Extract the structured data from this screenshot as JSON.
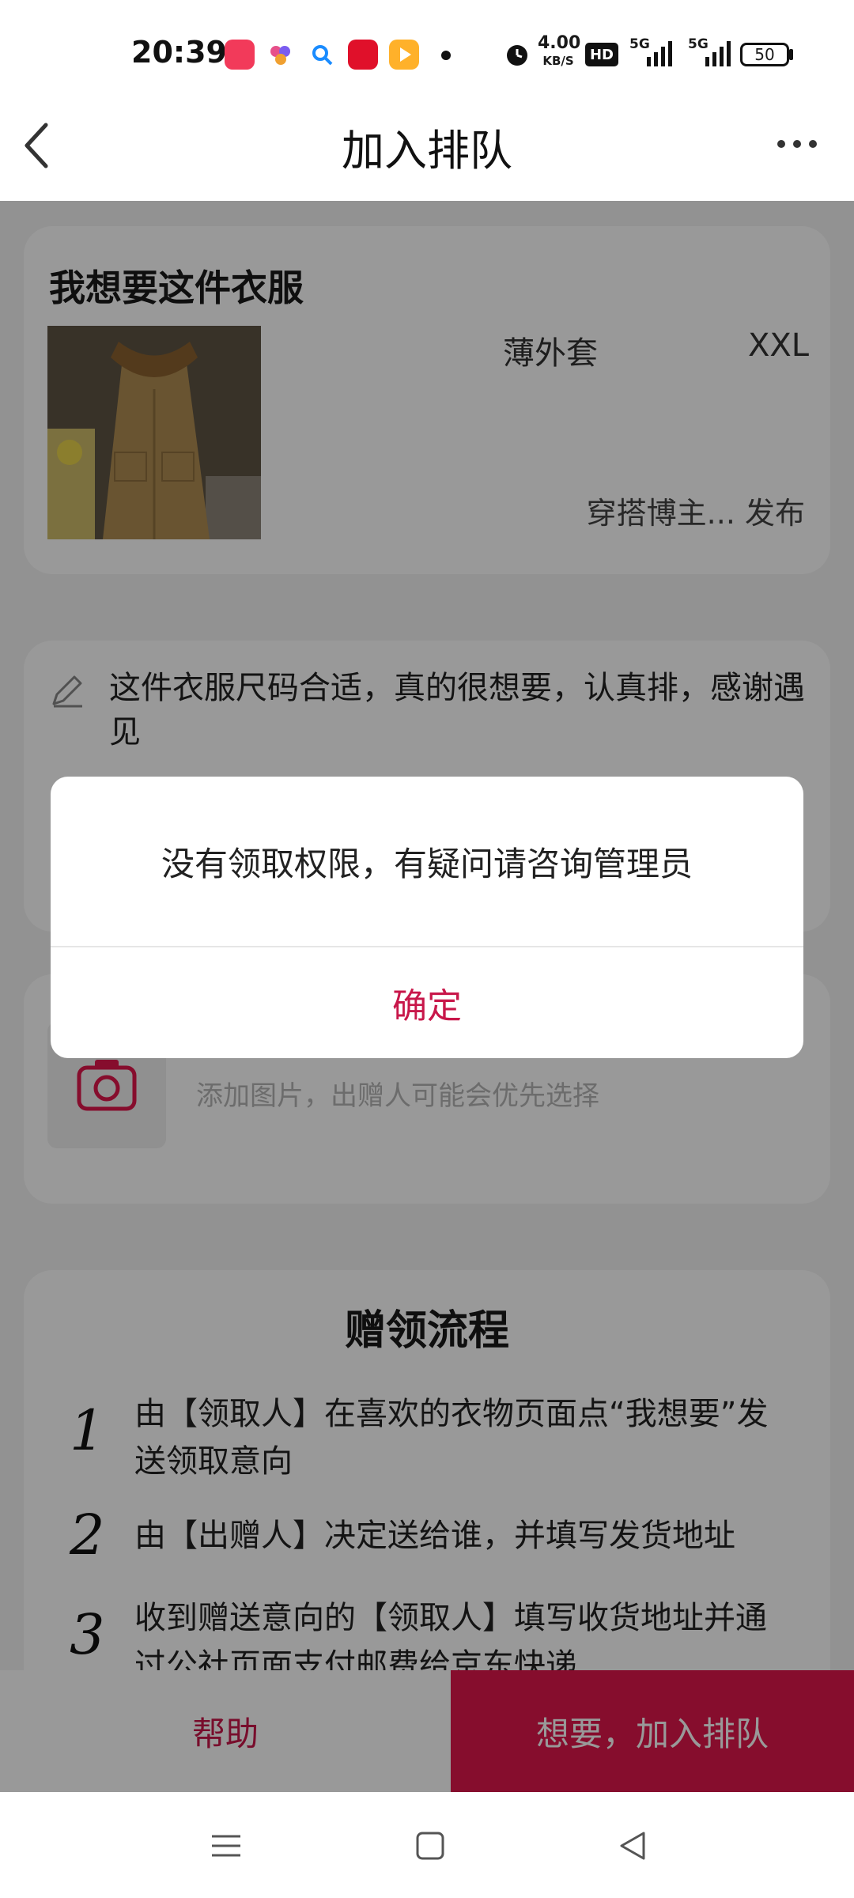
{
  "status_bar": {
    "time": "20:39",
    "net_speed": "4.00",
    "net_unit": "KB/S",
    "hd": "HD",
    "signal1": "5G",
    "signal2": "5G",
    "battery": "50"
  },
  "header": {
    "title": "加入排队"
  },
  "item": {
    "heading": "我想要这件衣服",
    "category": "薄外套",
    "size": "XXL",
    "publisher": "穿搭博主... 发布"
  },
  "note": {
    "text": "这件衣服尺码合适，真的很想要，认真排，感谢遇见"
  },
  "upload": {
    "hint": "添加图片，出赠人可能会优先选择"
  },
  "flow": {
    "title": "赠领流程",
    "steps": [
      {
        "num": "1",
        "text": "由【领取人】在喜欢的衣物页面点“我想要”发送领取意向"
      },
      {
        "num": "2",
        "text": "由【出赠人】决定送给谁，并填写发货地址"
      },
      {
        "num": "3",
        "text": "收到赠送意向的【领取人】填写收货地址并通过公社页面支付邮费给京东快递"
      }
    ]
  },
  "actions": {
    "help": "帮助",
    "join": "想要，加入排队"
  },
  "dialog": {
    "message": "没有领取权限，有疑问请咨询管理员",
    "confirm": "确定"
  },
  "colors": {
    "accent": "#e0174b",
    "accent_text": "#c8174a"
  }
}
